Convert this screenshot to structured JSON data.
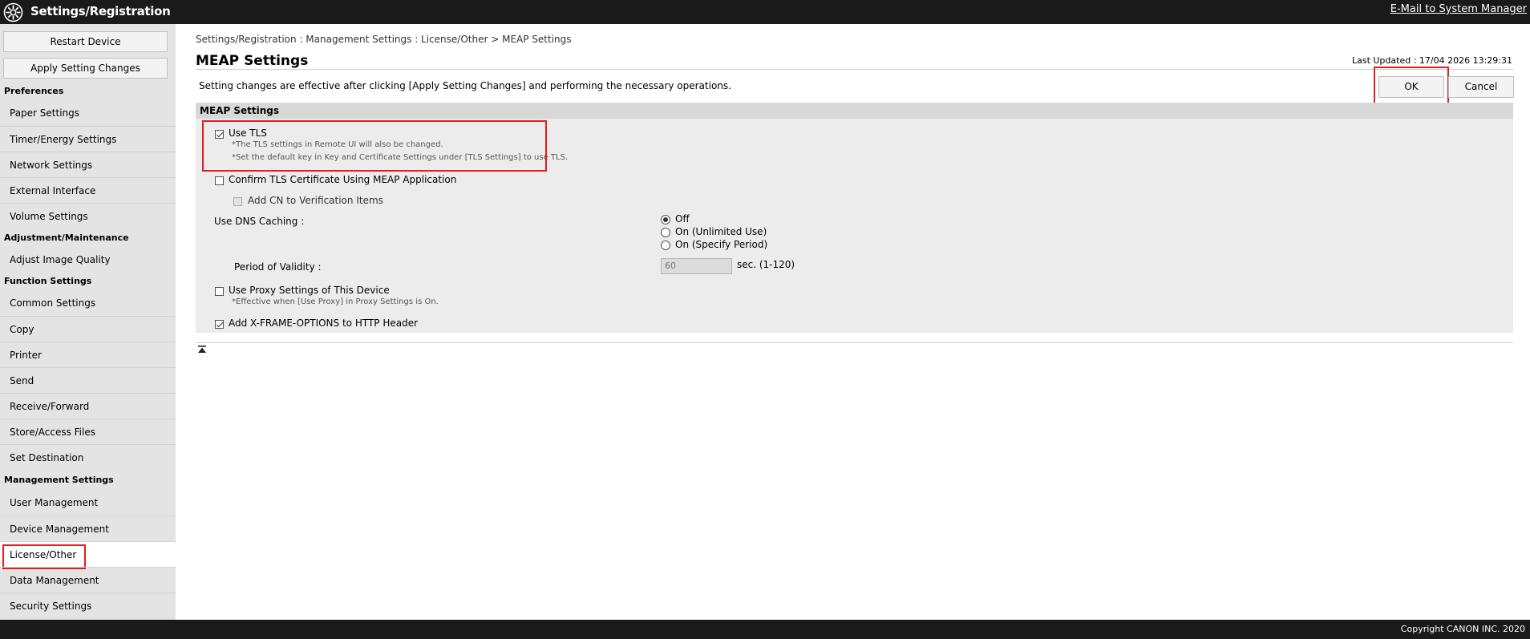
{
  "header": {
    "title": "Settings/Registration",
    "email_link": "E-Mail to System Manager"
  },
  "sidebar": {
    "restart_label": "Restart Device",
    "apply_label": "Apply Setting Changes",
    "sections": [
      {
        "title": "Preferences",
        "items": [
          "Paper Settings",
          "Timer/Energy Settings",
          "Network Settings",
          "External Interface",
          "Volume Settings"
        ]
      },
      {
        "title": "Adjustment/Maintenance",
        "items": [
          "Adjust Image Quality"
        ]
      },
      {
        "title": "Function Settings",
        "items": [
          "Common Settings",
          "Copy",
          "Printer",
          "Send",
          "Receive/Forward",
          "Store/Access Files",
          "Set Destination"
        ]
      },
      {
        "title": "Management Settings",
        "items": [
          "User Management",
          "Device Management",
          "License/Other",
          "Data Management",
          "Security Settings"
        ]
      }
    ],
    "active_item": "License/Other"
  },
  "main": {
    "breadcrumb": "Settings/Registration : Management Settings : License/Other > MEAP Settings",
    "title": "MEAP Settings",
    "last_updated": "Last Updated : 17/04 2026 13:29:31",
    "notice": "Setting changes are effective after clicking [Apply Setting Changes] and performing the necessary operations.",
    "ok_label": "OK",
    "cancel_label": "Cancel"
  },
  "panel": {
    "title": "MEAP Settings",
    "use_tls": {
      "label": "Use TLS",
      "checked": true,
      "note1": "*The TLS settings in Remote UI will also be changed.",
      "note2": "*Set the default key in Key and Certificate Settings under [TLS Settings] to use TLS."
    },
    "confirm_tls": {
      "label": "Confirm TLS Certificate Using MEAP Application",
      "checked": false
    },
    "add_cn": {
      "label": "Add CN to Verification Items",
      "checked": false,
      "disabled": true
    },
    "dns_caching": {
      "label": "Use DNS Caching :",
      "options": [
        "Off",
        "On (Unlimited Use)",
        "On (Specify Period)"
      ],
      "selected": "Off"
    },
    "period": {
      "label": "Period of Validity :",
      "value": "60",
      "unit": "sec. (1-120)"
    },
    "proxy": {
      "label": "Use Proxy Settings of This Device",
      "checked": false,
      "note": "*Effective when [Use Proxy] in Proxy Settings is On."
    },
    "xframe": {
      "label": "Add X-FRAME-OPTIONS to HTTP Header",
      "checked": true
    }
  },
  "footer": {
    "copyright": "Copyright CANON INC. 2020"
  }
}
